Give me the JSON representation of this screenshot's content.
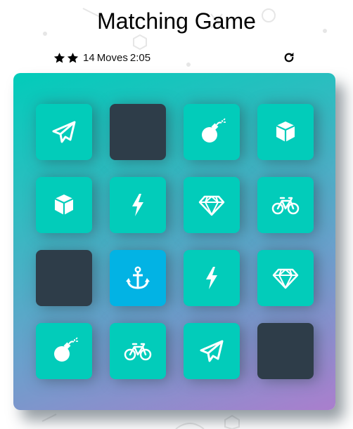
{
  "title": "Matching Game",
  "score": {
    "stars_filled": 2,
    "moves": "14",
    "moves_label": "Moves",
    "timer": "2:05"
  },
  "colors": {
    "card_closed": "#2e3d49",
    "card_match": "#02ccba",
    "card_open": "#02b3e4"
  },
  "cards": [
    {
      "state": "match",
      "icon": "paper-plane-icon"
    },
    {
      "state": "closed",
      "icon": ""
    },
    {
      "state": "match",
      "icon": "bomb-icon"
    },
    {
      "state": "match",
      "icon": "cube-icon"
    },
    {
      "state": "match",
      "icon": "cube-icon"
    },
    {
      "state": "match",
      "icon": "bolt-icon"
    },
    {
      "state": "match",
      "icon": "diamond-icon"
    },
    {
      "state": "match",
      "icon": "bicycle-icon"
    },
    {
      "state": "closed",
      "icon": ""
    },
    {
      "state": "open",
      "icon": "anchor-icon"
    },
    {
      "state": "match",
      "icon": "bolt-icon"
    },
    {
      "state": "match",
      "icon": "diamond-icon"
    },
    {
      "state": "match",
      "icon": "bomb-icon"
    },
    {
      "state": "match",
      "icon": "bicycle-icon"
    },
    {
      "state": "match",
      "icon": "paper-plane-icon"
    },
    {
      "state": "closed",
      "icon": ""
    }
  ]
}
